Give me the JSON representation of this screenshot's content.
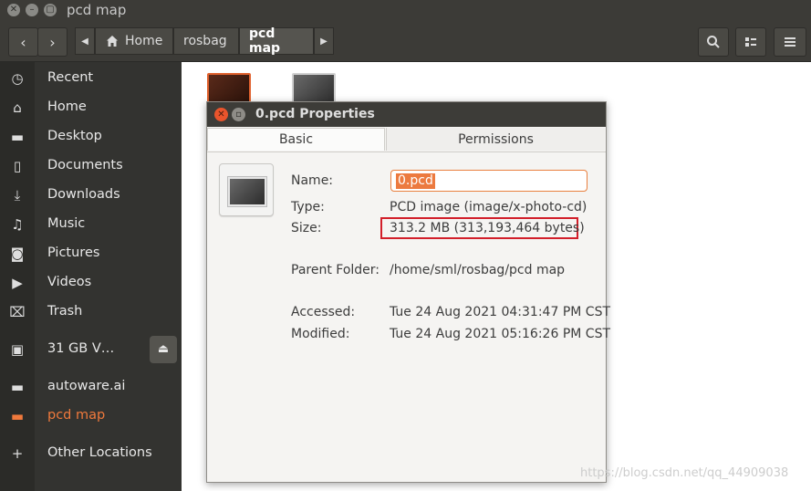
{
  "window": {
    "title": "pcd map"
  },
  "toolbar": {
    "back_icon": "chevron-left-icon",
    "forward_icon": "chevron-right-icon",
    "breadcrumbs": [
      "Home",
      "rosbag",
      "pcd map"
    ],
    "search_icon": "search-icon",
    "view_icon": "view-toggle-icon",
    "menu_icon": "hamburger-menu-icon"
  },
  "sidebar": {
    "items": [
      {
        "label": "Recent",
        "icon": "clock-icon"
      },
      {
        "label": "Home",
        "icon": "home-icon"
      },
      {
        "label": "Desktop",
        "icon": "folder-icon"
      },
      {
        "label": "Documents",
        "icon": "document-icon"
      },
      {
        "label": "Downloads",
        "icon": "download-icon"
      },
      {
        "label": "Music",
        "icon": "music-icon"
      },
      {
        "label": "Pictures",
        "icon": "camera-icon"
      },
      {
        "label": "Videos",
        "icon": "video-icon"
      },
      {
        "label": "Trash",
        "icon": "trash-icon"
      },
      {
        "label": "31 GB V…",
        "icon": "drive-icon"
      },
      {
        "label": "autoware.ai",
        "icon": "folder-icon"
      },
      {
        "label": "pcd map",
        "icon": "folder-icon"
      },
      {
        "label": "Other Locations",
        "icon": "plus-icon"
      }
    ],
    "active_item": "pcd map",
    "accent_color": "#f0793c"
  },
  "dialog": {
    "title": "0.pcd Properties",
    "tabs": [
      "Basic",
      "Permissions"
    ],
    "selected_tab": "Basic",
    "fields": {
      "name_label": "Name:",
      "name_value": "0.pcd",
      "type_label": "Type:",
      "type_value": "PCD image (image/x-photo-cd)",
      "size_label": "Size:",
      "size_value": "313.2 MB (313,193,464 bytes)",
      "parent_label": "Parent Folder:",
      "parent_value": "/home/sml/rosbag/pcd map",
      "accessed_label": "Accessed:",
      "accessed_value": "Tue 24 Aug 2021 04:31:47 PM CST",
      "modified_label": "Modified:",
      "modified_value": "Tue 24 Aug 2021 05:16:26 PM CST"
    },
    "highlight_color": "#d21f2a"
  },
  "watermark": "https://blog.csdn.net/qq_44909038"
}
